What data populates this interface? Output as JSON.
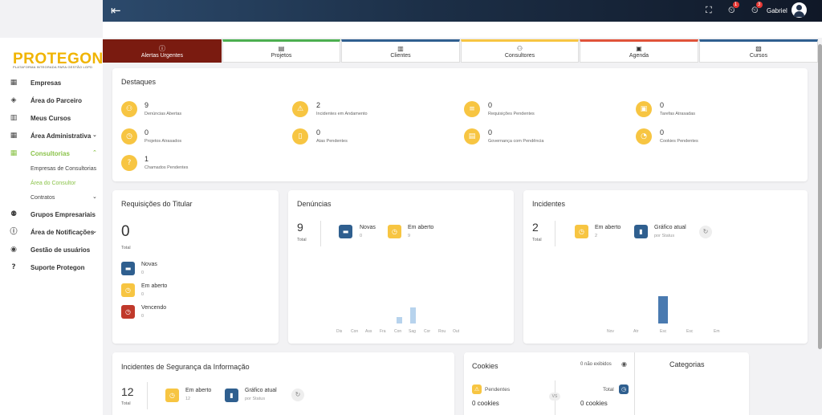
{
  "topbar": {
    "user": "Gabriel",
    "badge1": "1",
    "badge2": "3"
  },
  "logo": {
    "name": "PROTEGON",
    "tagline": "PLATAFORMA INTEGRADA PARA GESTÃO LGPD"
  },
  "sidebar": {
    "empresas": "Empresas",
    "parceiro": "Área do Parceiro",
    "cursos": "Meus Cursos",
    "admin": "Área Administrativa",
    "consultorias": "Consultorias",
    "sub_empresas": "Empresas de Consultorias",
    "sub_consultor": "Área do Consultor",
    "sub_contratos": "Contratos",
    "grupos": "Grupos Empresariais",
    "notificacoes": "Área de Notificações",
    "usuarios": "Gestão de usuários",
    "suporte": "Suporte Protegon"
  },
  "tabs": {
    "alertas": "Alertas Urgentes",
    "projetos": "Projetos",
    "clientes": "Clientes",
    "consultores": "Consultores",
    "agenda": "Agenda",
    "cursos": "Cursos"
  },
  "destaques": {
    "title": "Destaques",
    "items": [
      {
        "num": "9",
        "label": "Denúncias Abertas"
      },
      {
        "num": "2",
        "label": "Incidentes em Andamento"
      },
      {
        "num": "0",
        "label": "Requisições Pendentes"
      },
      {
        "num": "0",
        "label": "Tarefas Atrasadas"
      },
      {
        "num": "0",
        "label": "Projetos Atrasados"
      },
      {
        "num": "0",
        "label": "Atas Pendentes"
      },
      {
        "num": "0",
        "label": "Governança com Pendência"
      },
      {
        "num": "0",
        "label": "Cookies Pendentes"
      },
      {
        "num": "1",
        "label": "Chamados Pendentes"
      }
    ]
  },
  "requisicoes": {
    "title": "Requisições do Titular",
    "total": "0",
    "total_label": "Total",
    "novas": "Novas",
    "novas_v": "0",
    "aberto": "Em aberto",
    "aberto_v": "0",
    "vencendo": "Vencendo",
    "vencendo_v": "0"
  },
  "denuncias": {
    "title": "Denúncias",
    "total": "9",
    "total_label": "Total",
    "novas": "Novas",
    "novas_v": "0",
    "aberto": "Em aberto",
    "aberto_v": "9",
    "months": [
      "Dis",
      "Con",
      "Ass",
      "Fra",
      "Con",
      "Sag",
      "Cor",
      "Rou",
      "Out"
    ]
  },
  "incidentes": {
    "title": "Incidentes",
    "total": "2",
    "total_label": "Total",
    "aberto": "Em aberto",
    "aberto_v": "2",
    "grafico": "Gráfico atual",
    "grafico_sub": "por Status",
    "cats": [
      "Nov",
      "Atr",
      "Esc",
      "Esc",
      "Em"
    ]
  },
  "seguranca": {
    "title": "Incidentes de Segurança da Informação",
    "total": "12",
    "total_label": "Total",
    "aberto": "Em aberto",
    "aberto_v": "12",
    "grafico": "Gráfico atual",
    "grafico_sub": "por Status"
  },
  "cookies": {
    "title": "Cookies",
    "hidden": "0 não exibidos",
    "pendentes": "Pendentes",
    "pendentes_v": "0 cookies",
    "vs": "VS",
    "total": "Total",
    "total_v": "0 cookies",
    "categorias": "Categorias"
  },
  "colors": {
    "accent": "#f7c542",
    "alert": "#7a1b10",
    "blue": "#2f5f8f",
    "red": "#c0392b",
    "green": "#8bc34a"
  }
}
